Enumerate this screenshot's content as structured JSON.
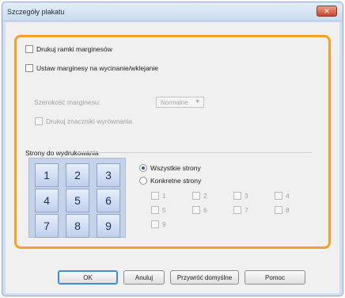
{
  "window": {
    "title": "Szczegóły plakatu",
    "close_label": "✕"
  },
  "options": {
    "print_margin_lines": "Drukuj ramki marginesów",
    "set_margins": "Ustaw marginesy na wycinanie/wklejanie",
    "margin_width_label": "Szerokość marginesu:",
    "margin_width_value": "Normalne",
    "print_alignment_marks": "Drukuj znaczniki wyrównania"
  },
  "pages_section": {
    "label": "Strony do wydrukowania",
    "tiles": [
      "1",
      "2",
      "3",
      "4",
      "5",
      "6",
      "7",
      "8",
      "9"
    ],
    "all_pages": "Wszystkie strony",
    "specific_pages": "Konkretne strony",
    "page_checks": [
      "1",
      "2",
      "3",
      "4",
      "5",
      "6",
      "7",
      "8",
      "9"
    ]
  },
  "buttons": {
    "ok": "OK",
    "cancel": "Anuluj",
    "restore_defaults": "Przywróć domyślne",
    "help": "Pomoc"
  }
}
